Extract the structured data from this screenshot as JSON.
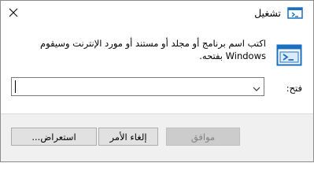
{
  "window": {
    "title": "تشغيل",
    "close_glyph": "✕"
  },
  "icons": {
    "title": "run-icon",
    "big": "run-icon",
    "close": "close-icon",
    "dropdown": "chevron-down-icon"
  },
  "dialog": {
    "description": "اكتب اسم برنامج أو مجلد أو مستند أو مورد الإنترنت وسيقوم Windows بفتحه.",
    "open_label": "فتح:",
    "open_value": ""
  },
  "buttons": {
    "ok": "موافق",
    "cancel": "إلغاء الأمر",
    "browse": "استعراض..."
  },
  "colors": {
    "accent": "#1a6fc0",
    "footer_bg": "#f0f0f0",
    "disabled_text": "#838383"
  }
}
